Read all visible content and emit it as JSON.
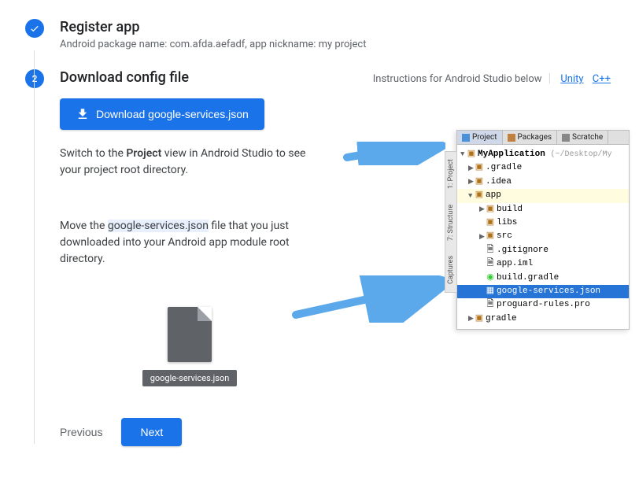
{
  "step1": {
    "title": "Register app",
    "subtitle": "Android package name: com.afda.aefadf, app nickname: my project"
  },
  "step2": {
    "number": "2",
    "title": "Download config file",
    "instructions_text": "Instructions for Android Studio below",
    "link_unity": "Unity",
    "link_cpp": "C++",
    "download_btn": "Download google-services.json",
    "para1_pre": "Switch to the ",
    "para1_bold": "Project",
    "para1_post": " view in Android Studio to see your project root directory.",
    "para2_pre": "Move the ",
    "para2_hl": "google-services.json",
    "para2_post": " file that you just downloaded into your Android app module root directory.",
    "file_label": "google-services.json",
    "prev_btn": "Previous",
    "next_btn": "Next"
  },
  "ide": {
    "tabs": {
      "project": "Project",
      "packages": "Packages",
      "scratches": "Scratche"
    },
    "project_name": "MyApplication",
    "project_path": "(~/Desktop/My",
    "tree": {
      "gradle_dir": ".gradle",
      "idea": ".idea",
      "app": "app",
      "build": "build",
      "libs": "libs",
      "src": "src",
      "gitignore": ".gitignore",
      "appiml": "app.iml",
      "buildgradle": "build.gradle",
      "gservices": "google-services.json",
      "proguard": "proguard-rules.pro",
      "gradle_dir2": "gradle"
    },
    "sidebar": {
      "project": "1: Project",
      "structure": "7: Structure",
      "captures": "Captures"
    }
  }
}
